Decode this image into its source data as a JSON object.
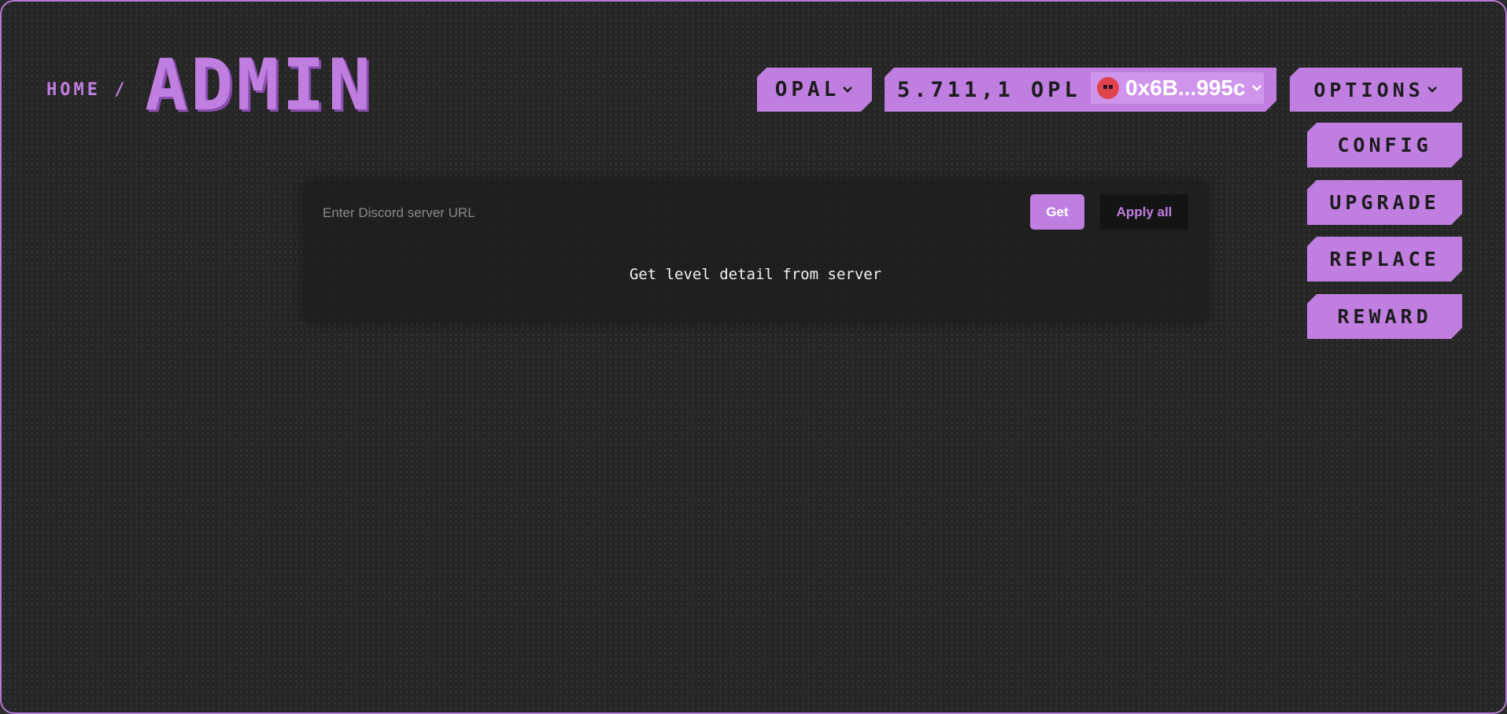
{
  "breadcrumb": {
    "home": "HOME /"
  },
  "page": {
    "title": "ADMIN"
  },
  "header": {
    "token_selector": "OPAL",
    "balance": "5.711,1 OPL",
    "wallet_address": "0x6B...995c",
    "options_label": "OPTIONS"
  },
  "side_menu": {
    "config": "CONFIG",
    "upgrade": "UPGRADE",
    "replace": "REPLACE",
    "reward": "REWARD"
  },
  "panel": {
    "url_placeholder": "Enter Discord server URL",
    "url_value": "",
    "get_label": "Get",
    "apply_all_label": "Apply all",
    "detail_text": "Get level detail from server"
  },
  "colors": {
    "accent": "#c07ee0",
    "background": "#262626",
    "border": "#b57ad6"
  },
  "icons": [
    "chevron-down-icon",
    "avatar-icon"
  ]
}
